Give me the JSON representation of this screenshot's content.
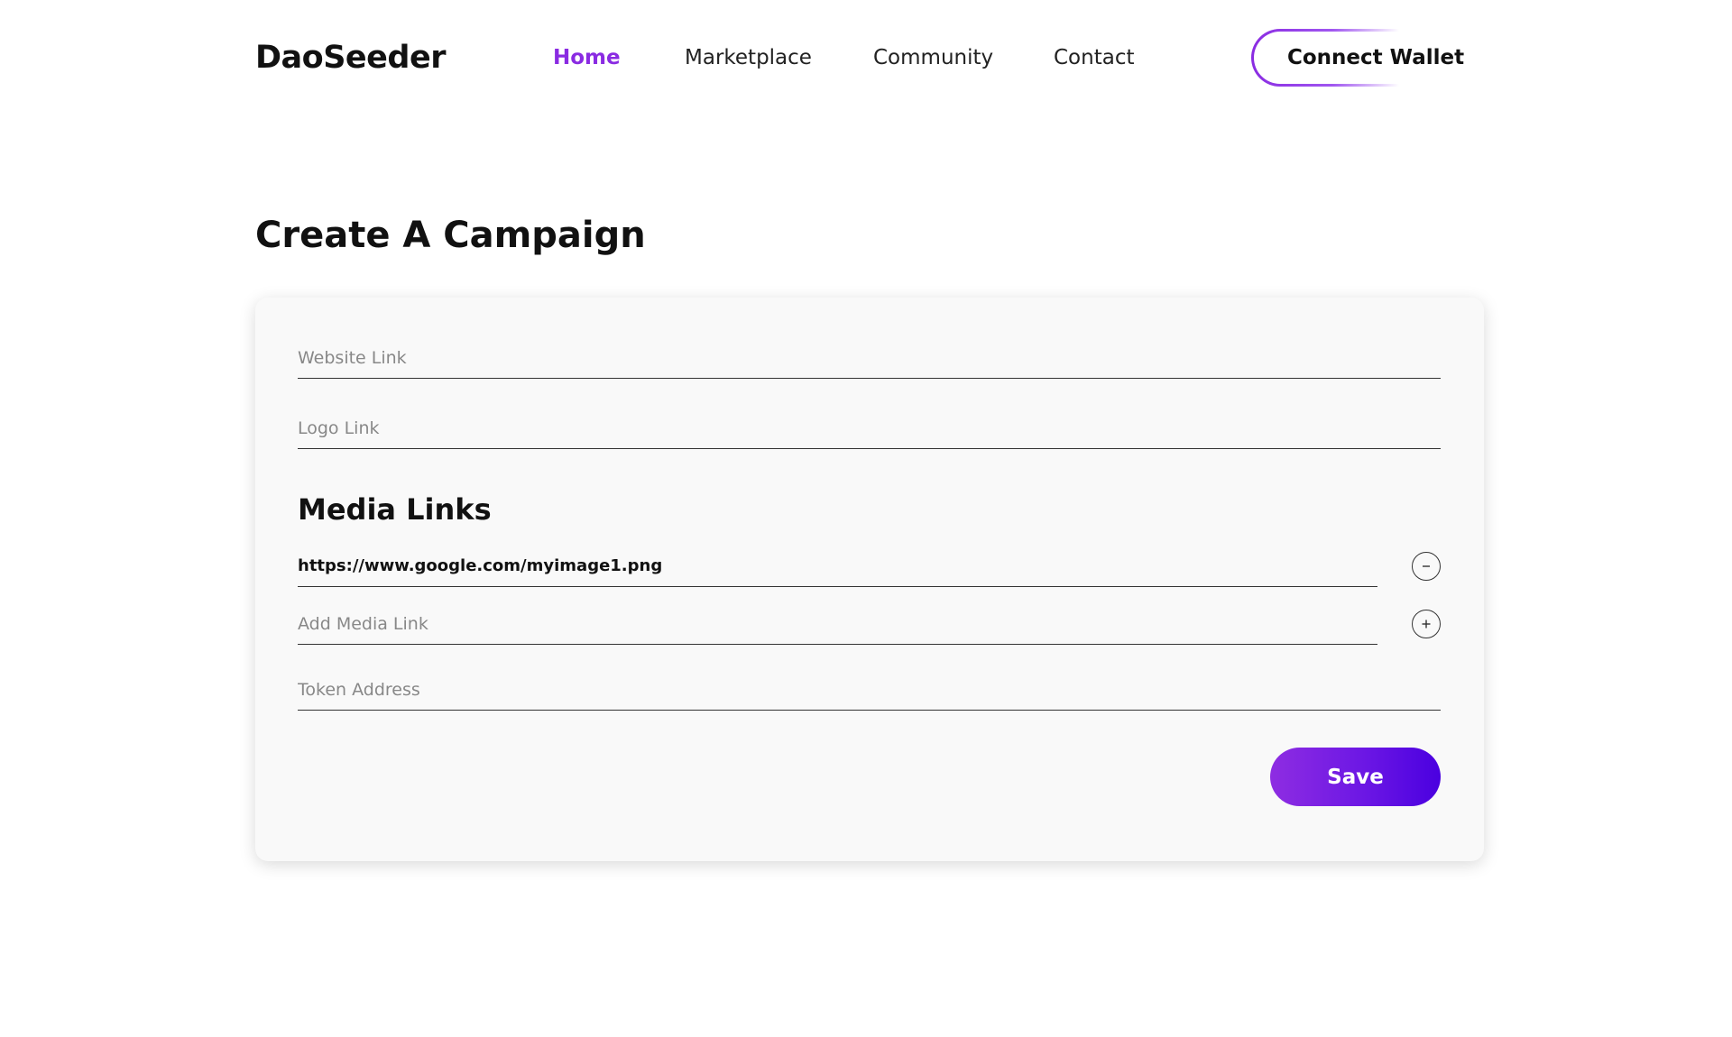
{
  "brand": "DaoSeeder",
  "nav": {
    "items": [
      {
        "label": "Home",
        "active": true
      },
      {
        "label": "Marketplace",
        "active": false
      },
      {
        "label": "Community",
        "active": false
      },
      {
        "label": "Contact",
        "active": false
      }
    ],
    "wallet_label": "Connect Wallet"
  },
  "page_title": "Create A Campaign",
  "form": {
    "website_placeholder": "Website Link",
    "logo_placeholder": "Logo Link",
    "media_section_title": "Media Links",
    "media_links": [
      {
        "value": "https://www.google.com/myimage1.png",
        "action_icon": "minus-circle-icon"
      }
    ],
    "add_media_placeholder": "Add Media Link",
    "add_media_icon": "plus-circle-icon",
    "token_placeholder": "Token Address",
    "save_label": "Save"
  },
  "colors": {
    "accent": "#8a2be2",
    "save_gradient_start": "#8e2de2",
    "save_gradient_end": "#4a00e0",
    "card_background": "#f9f9f9"
  }
}
